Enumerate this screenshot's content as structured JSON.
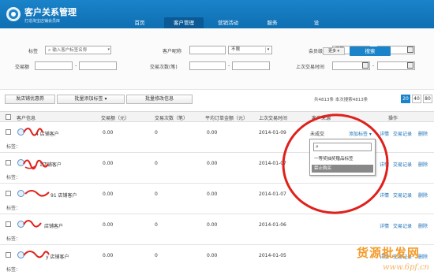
{
  "header": {
    "title": "客户关系管理",
    "subtitle": "打造淘宝店铺会员库",
    "nav": [
      "首页",
      "客户管理",
      "营销活动",
      "服务",
      "设"
    ],
    "active_index": 1
  },
  "filters": {
    "tag_label": "标签",
    "tag_placeholder": "输入客户标签名称",
    "nickname_label": "客户昵称",
    "nickname_select": "不限",
    "level_label": "会员级别",
    "level_select": "不限",
    "amount_label": "交易额",
    "count_label": "交易次数(笔)",
    "last_trade_label": "上次交易时间",
    "dash": "-",
    "more_label": "更多",
    "search_label": "搜索"
  },
  "toolbar": {
    "coupon_label": "发店铺优惠券",
    "batch_tag_label": "批量添加标签",
    "batch_edit_label": "批量修改信息",
    "total_text": "共4813条 本次搜索4813条",
    "page_sizes": [
      "20",
      "40",
      "80"
    ]
  },
  "table": {
    "headers": [
      "客户信息",
      "交易额（元）",
      "交易次数（笔）",
      "平均订单金额（元）",
      "上次交易时间",
      "客户来源",
      "操作"
    ],
    "tag_prefix": "标签：",
    "rows": [
      {
        "name": "4 店铺客户",
        "amount": "0.00",
        "count": "0",
        "avg": "0.00",
        "date": "2014-01-09",
        "source": "未成交",
        "add_tag": "添加标签"
      },
      {
        "name": "1店铺客户",
        "amount": "0.00",
        "count": "0",
        "avg": "0.00",
        "date": "2014-01-07",
        "source": "",
        "add_tag": ""
      },
      {
        "name": "91 店铺客户",
        "amount": "0.00",
        "count": "0",
        "avg": "0.00",
        "date": "2014-01-07",
        "source": "",
        "add_tag": ""
      },
      {
        "name": "店铺客户",
        "amount": "0.00",
        "count": "0",
        "avg": "0.00",
        "date": "2014-01-06",
        "source": "",
        "add_tag": ""
      },
      {
        "name": "y 店铺客户",
        "amount": "0.00",
        "count": "0",
        "avg": "0.00",
        "date": "2014-01-05",
        "source": "",
        "add_tag": ""
      }
    ],
    "actions": {
      "detail": "详情",
      "trade_record": "交易记录",
      "delete": "删除"
    }
  },
  "popup": {
    "items": [
      "一等奖抽奖赠品标签",
      "禁止购买"
    ],
    "selected_index": 1
  },
  "watermark": {
    "text": "货源批发网",
    "url": "www.6pf.cn"
  },
  "colors": {
    "brand": "#1a83c9",
    "link": "#1a6fb8",
    "annotation": "#e0201b"
  }
}
